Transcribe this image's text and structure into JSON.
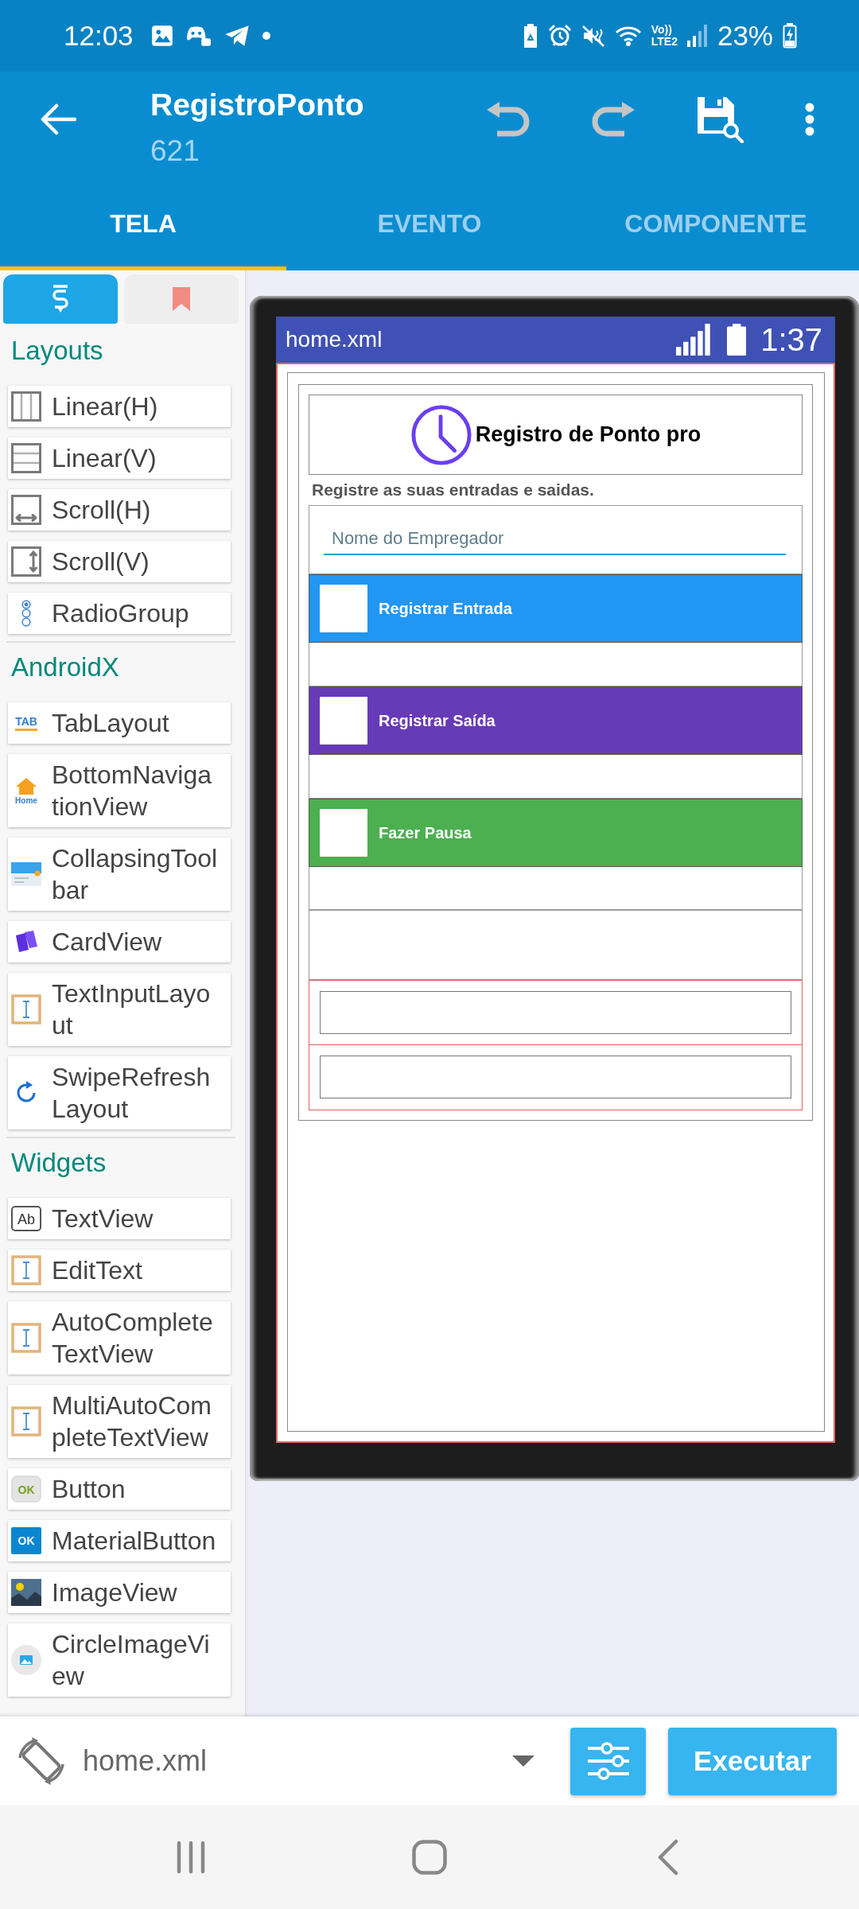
{
  "status_bar": {
    "time": "12:03",
    "volte": "Vo))",
    "network": "LTE2",
    "battery": "23%"
  },
  "app_bar": {
    "title": "RegistroPonto",
    "subtitle": "621",
    "actions": [
      {
        "kind": "undo",
        "disabled": true
      },
      {
        "kind": "redo",
        "disabled": true
      },
      {
        "kind": "save",
        "disabled": false
      },
      {
        "kind": "more",
        "disabled": false
      }
    ]
  },
  "tabs": [
    {
      "label": "TELA",
      "selected": true
    },
    {
      "label": "EVENTO",
      "selected": false
    },
    {
      "label": "COMPONENTE",
      "selected": false
    }
  ],
  "palette": {
    "toggles": [
      {
        "kind": "widgets",
        "selected": true
      },
      {
        "kind": "bookmarks",
        "selected": false
      }
    ],
    "sections": [
      {
        "title": "Layouts",
        "items": [
          {
            "label": "Linear(H)",
            "kind": "linear-h"
          },
          {
            "label": "Linear(V)",
            "kind": "linear-v"
          },
          {
            "label": "Scroll(H)",
            "kind": "scroll-h"
          },
          {
            "label": "Scroll(V)",
            "kind": "scroll-v"
          },
          {
            "label": "RadioGroup",
            "kind": "radio"
          }
        ]
      },
      {
        "title": "AndroidX",
        "items": [
          {
            "label": "TabLayout",
            "kind": "tab",
            "icon_text": "TAB"
          },
          {
            "label": "BottomNavigationView",
            "kind": "bottom-nav",
            "icon_text": "Home"
          },
          {
            "label": "CollapsingToolbar",
            "kind": "toolbar"
          },
          {
            "label": "CardView",
            "kind": "card"
          },
          {
            "label": "TextInputLayout",
            "kind": "input"
          },
          {
            "label": "SwipeRefreshLayout",
            "kind": "refresh"
          }
        ]
      },
      {
        "title": "Widgets",
        "items": [
          {
            "label": "TextView",
            "kind": "text",
            "icon_text": "Ab"
          },
          {
            "label": "EditText",
            "kind": "input"
          },
          {
            "label": "AutoCompleteTextView",
            "kind": "input"
          },
          {
            "label": "MultiAutoCompleteTextView",
            "kind": "input"
          },
          {
            "label": "Button",
            "kind": "button",
            "icon_text": "OK"
          },
          {
            "label": "MaterialButton",
            "kind": "material-button",
            "icon_text": "OK"
          },
          {
            "label": "ImageView",
            "kind": "image"
          },
          {
            "label": "CircleImageView",
            "kind": "circle-image"
          }
        ]
      }
    ]
  },
  "preview": {
    "file": "home.xml",
    "clock": "1:37",
    "header": "Registro de Ponto pro",
    "description": "Registre as suas entradas e saidas.",
    "input": {
      "placeholder": "Nome do Empregador"
    },
    "buttons": [
      {
        "label": "Registrar Entrada",
        "color": "#2196f3"
      },
      {
        "label": "Registrar Saída",
        "color": "#673ab7"
      },
      {
        "label": "Fazer Pausa",
        "color": "#4caf50"
      }
    ]
  },
  "bottom_bar": {
    "file": "home.xml",
    "run": "Executar"
  }
}
